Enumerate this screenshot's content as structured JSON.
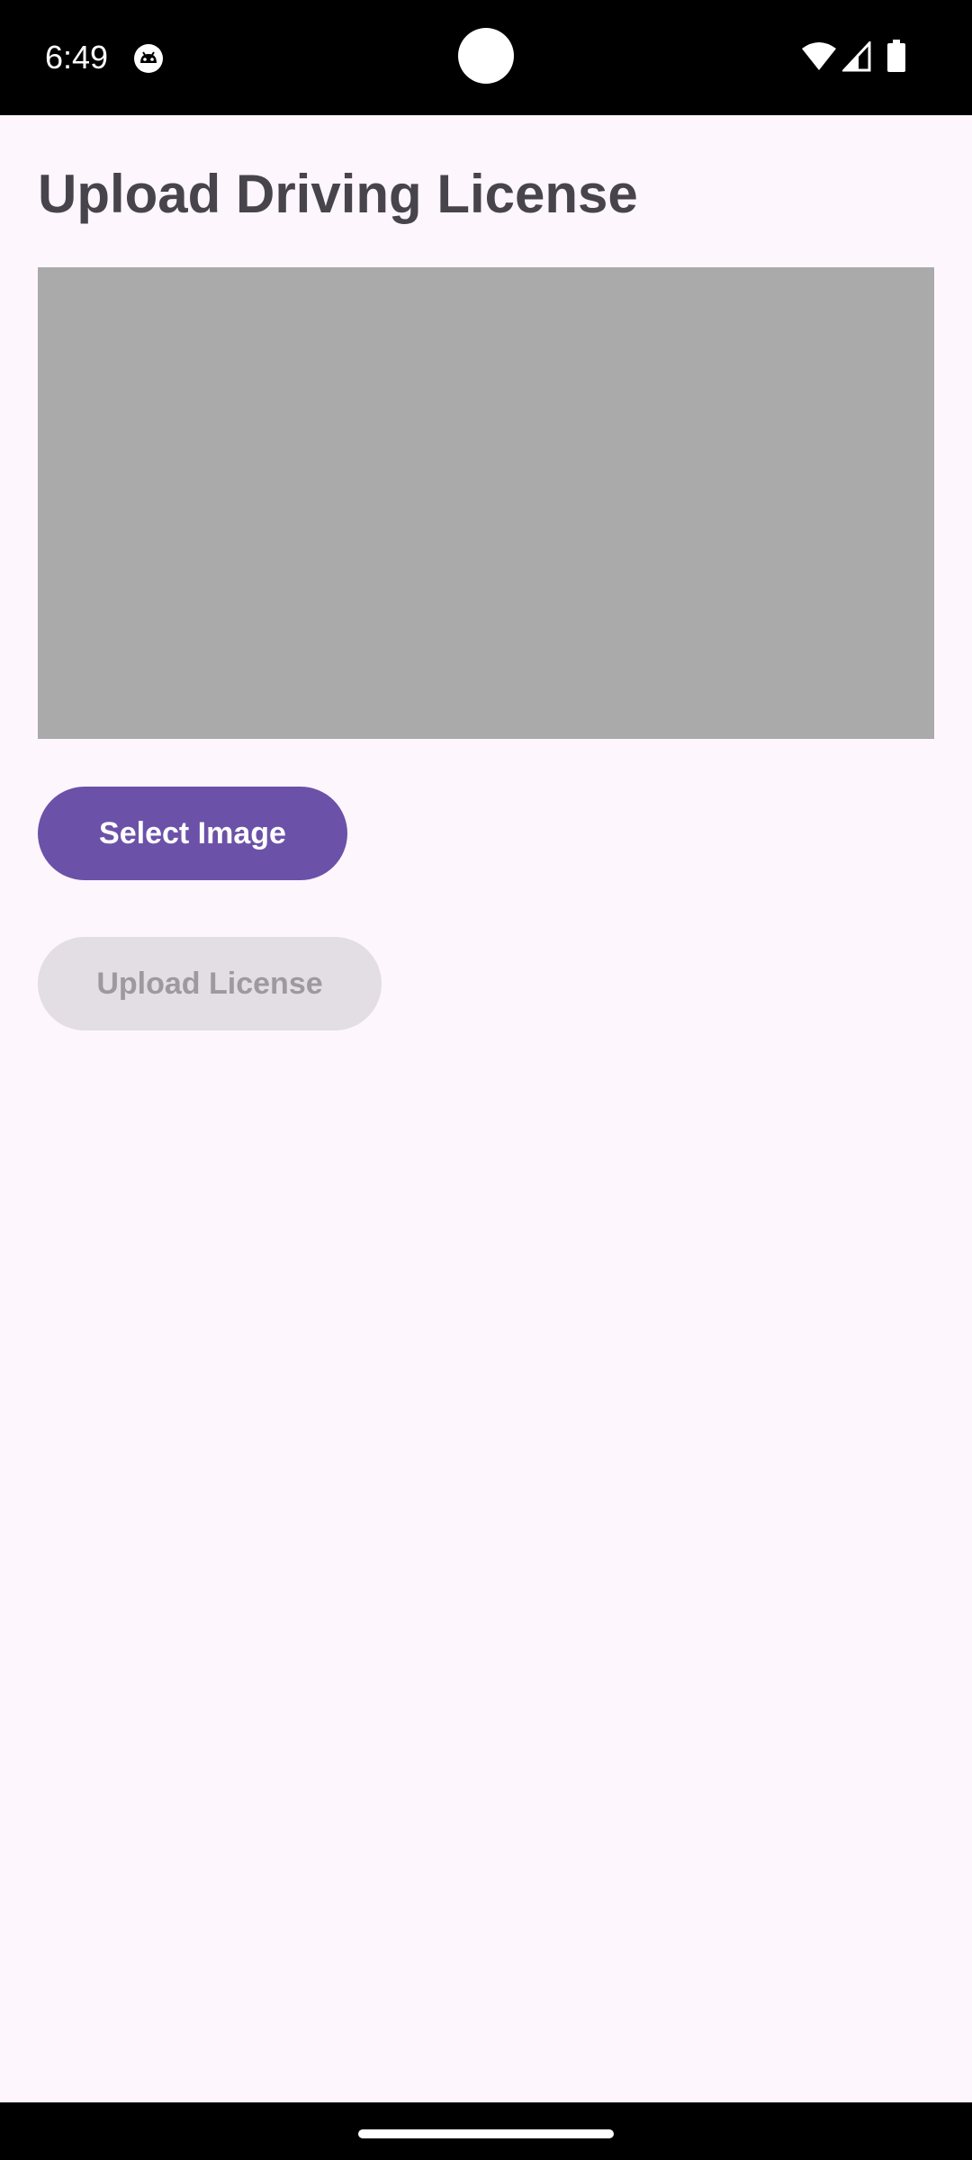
{
  "status_bar": {
    "time": "6:49",
    "app_icon": "android-robot-icon",
    "wifi_icon": "wifi-icon",
    "signal_icon": "cellular-signal-icon",
    "battery_icon": "battery-icon"
  },
  "page": {
    "title": "Upload Driving License",
    "preview_placeholder_color": "#aaaaaa"
  },
  "actions": {
    "select_image_label": "Select Image",
    "upload_license_label": "Upload License",
    "upload_license_enabled": false
  },
  "colors": {
    "background": "#fdf6fd",
    "primary": "#6b52a8",
    "disabled_button": "#e3dde4",
    "disabled_text": "#9e999f",
    "title_text": "#47444c"
  }
}
